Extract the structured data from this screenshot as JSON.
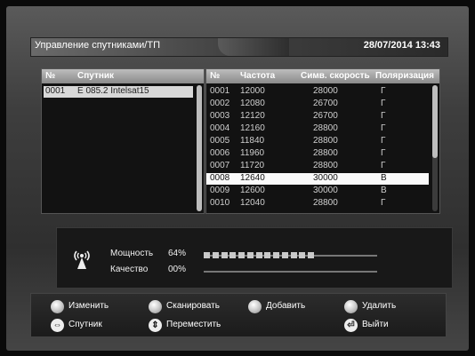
{
  "header": {
    "title": "Управление спутниками/ТП",
    "datetime": "28/07/2014 13:43"
  },
  "satellite_panel": {
    "col_num": "№",
    "col_name": "Спутник",
    "items": [
      {
        "num": "0001",
        "name": "E 085.2 Intelsat15"
      }
    ]
  },
  "transponder_panel": {
    "col_num": "№",
    "col_freq": "Частота",
    "col_symrate": "Симв. скорость",
    "col_pol": "Поляризация",
    "rows": [
      {
        "num": "0001",
        "freq": "12000",
        "sr": "28000",
        "pol": "Г"
      },
      {
        "num": "0002",
        "freq": "12080",
        "sr": "26700",
        "pol": "Г"
      },
      {
        "num": "0003",
        "freq": "12120",
        "sr": "26700",
        "pol": "Г"
      },
      {
        "num": "0004",
        "freq": "12160",
        "sr": "28800",
        "pol": "Г"
      },
      {
        "num": "0005",
        "freq": "11840",
        "sr": "28800",
        "pol": "Г"
      },
      {
        "num": "0006",
        "freq": "11960",
        "sr": "28800",
        "pol": "Г"
      },
      {
        "num": "0007",
        "freq": "11720",
        "sr": "28800",
        "pol": "Г"
      },
      {
        "num": "0008",
        "freq": "12640",
        "sr": "30000",
        "pol": "В"
      },
      {
        "num": "0009",
        "freq": "12600",
        "sr": "30000",
        "pol": "В"
      },
      {
        "num": "0010",
        "freq": "12040",
        "sr": "28800",
        "pol": "Г"
      }
    ],
    "selected_index": 7
  },
  "signal": {
    "power_label": "Мощность",
    "power_value": "64%",
    "power_fraction": 0.64,
    "quality_label": "Качество",
    "quality_value": "00%",
    "quality_fraction": 0.0
  },
  "buttons": {
    "edit": "Изменить",
    "scan": "Сканировать",
    "add": "Добавить",
    "delete": "Удалить",
    "satellite": "Спутник",
    "move": "Переместить",
    "exit": "Выйти"
  },
  "icons": {
    "antenna": "antenna-signal-icon",
    "color_buttons": "round-color-button-icon",
    "left_right": "left-right-arrows-icon",
    "up_down": "up-down-arrows-icon",
    "exit": "exit-icon"
  }
}
